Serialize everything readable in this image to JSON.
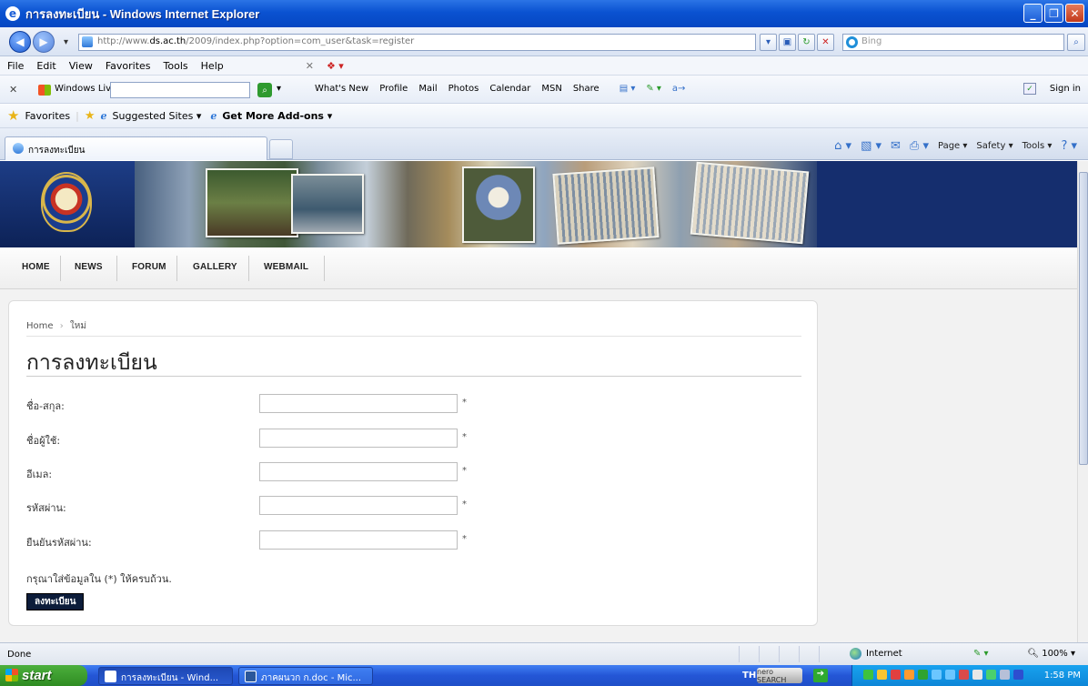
{
  "window": {
    "title": "การลงทะเบียน - Windows Internet Explorer"
  },
  "address": {
    "url_pre": "http://www.",
    "url_domain": "ds.ac.th",
    "url_post": "/2009/index.php?option=com_user&task=register",
    "search_placeholder": "Bing"
  },
  "menu": [
    "File",
    "Edit",
    "View",
    "Favorites",
    "Tools",
    "Help"
  ],
  "windows_live": {
    "label": "Windows Live",
    "links": [
      "What's New",
      "Profile",
      "Mail",
      "Photos",
      "Calendar",
      "MSN",
      "Share"
    ],
    "sign_in": "Sign in"
  },
  "favorites": {
    "label": "Favorites",
    "suggested": "Suggested Sites ▾",
    "addons": "Get More Add-ons ▾"
  },
  "tab": {
    "title": "การลงทะเบียน"
  },
  "commands": [
    "Page ▾",
    "Safety ▾",
    "Tools ▾"
  ],
  "site_nav": [
    "HOME",
    "NEWS",
    "FORUM",
    "GALLERY",
    "WEBMAIL"
  ],
  "breadcrumb": {
    "home": "Home",
    "sep": "›",
    "current": "ใหม่"
  },
  "heading": "การลงทะเบียน",
  "form": {
    "fields": [
      {
        "label": "ชื่อ-สกุล:",
        "value": "",
        "required": "*"
      },
      {
        "label": "ชื่อผู้ใช้:",
        "value": "",
        "required": "*"
      },
      {
        "label": "อีเมล:",
        "value": "",
        "required": "*"
      },
      {
        "label": "รหัสผ่าน:",
        "value": "",
        "required": "*"
      },
      {
        "label": "ยืนยันรหัสผ่าน:",
        "value": "",
        "required": "*"
      }
    ],
    "note": "กรุณาใส่ข้อมูลใน (*) ให้ครบถ้วน.",
    "submit": "ลงทะเบียน"
  },
  "status": {
    "text": "Done",
    "zone": "Internet",
    "zoom": "100%"
  },
  "taskbar": {
    "start": "start",
    "tasks": [
      "การลงทะเบียน - Wind...",
      "ภาคผนวก ก.doc - Mic..."
    ],
    "lang": "TH",
    "nero": "nero SEARCH",
    "clock": "1:58 PM"
  },
  "colors": {
    "titlebar": "#0a52d1",
    "banner": "#152e6e",
    "submit_bg": "#0c1c3a",
    "start": "#2f8c22"
  }
}
